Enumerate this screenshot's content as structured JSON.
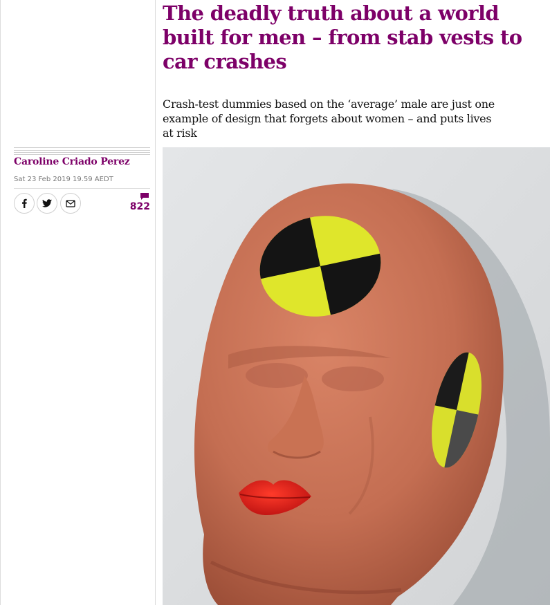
{
  "article": {
    "headline": "The deadly truth about a world built for men – from stab vests to car crashes",
    "standfirst": "Crash-test dummies based on the ‘average’ male are just one example of design that forgets about women – and puts lives at risk",
    "byline": "Caroline Criado Perez",
    "dateline": "Sat 23 Feb 2019 19.59 AEDT",
    "comment_count": "822"
  },
  "share": {
    "icons": [
      "facebook-icon",
      "twitter-icon",
      "email-icon"
    ],
    "comment_icon": "comment-bubble-icon"
  },
  "colors": {
    "accent": "#7d0068",
    "text": "#121212",
    "meta": "#767676",
    "divider": "#dcdcdc"
  },
  "hero_image": {
    "subject": "crash-test-dummy-head"
  }
}
